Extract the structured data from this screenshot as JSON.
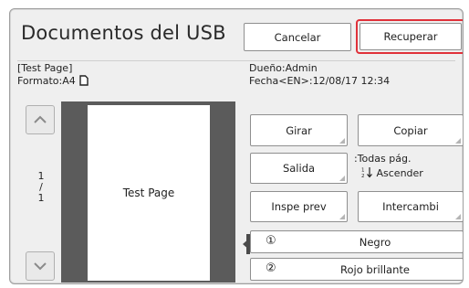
{
  "header": {
    "title": "Documentos del USB",
    "cancel_label": "Cancelar",
    "recover_label": "Recuperar"
  },
  "doc_info": {
    "name": "[Test Page]",
    "format": "Formato:A4",
    "owner": "Dueño:Admin",
    "date": "Fecha<EN>:12/08/17  12:34"
  },
  "preview": {
    "page_text": "Test Page",
    "page_current": "1",
    "page_sep": "/",
    "page_total": "1"
  },
  "actions": {
    "rotate_label": "Girar",
    "copy_label": "Copiar",
    "output_label": "Salida",
    "output_pages": ":Todas pág.",
    "output_order": "Ascender",
    "inspect_label": "Inspe prev",
    "exchange_label": "Intercambi"
  },
  "colors": [
    {
      "num": "①",
      "name": "Negro"
    },
    {
      "num": "②",
      "name": "Rojo brillante"
    }
  ],
  "accent": {
    "highlight": "#e0313a",
    "preview_bg": "#5b5b5b"
  }
}
